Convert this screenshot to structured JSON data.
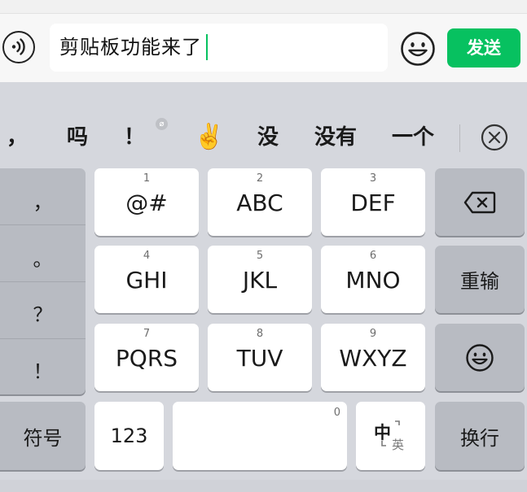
{
  "input": {
    "text": "剪贴板功能来了",
    "send_label": "发送"
  },
  "candidates": [
    {
      "text": "，"
    },
    {
      "text": "吗"
    },
    {
      "text": "！"
    },
    {
      "text": "✌️"
    },
    {
      "text": "没"
    },
    {
      "text": "没有"
    },
    {
      "text": "一个"
    }
  ],
  "punctuation": [
    "，",
    "。",
    "？",
    "！"
  ],
  "keys": [
    {
      "num": "1",
      "label": "@#"
    },
    {
      "num": "2",
      "label": "ABC"
    },
    {
      "num": "3",
      "label": "DEF"
    },
    {
      "num": "4",
      "label": "GHI"
    },
    {
      "num": "5",
      "label": "JKL"
    },
    {
      "num": "6",
      "label": "MNO"
    },
    {
      "num": "7",
      "label": "PQRS"
    },
    {
      "num": "8",
      "label": "TUV"
    },
    {
      "num": "9",
      "label": "WXYZ"
    }
  ],
  "side": {
    "retype_label": "重输",
    "symbols_label": "符号",
    "numbers_label": "123",
    "space_num": "0",
    "zh_label": "中",
    "en_label": "英",
    "newline_label": "换行"
  },
  "colors": {
    "accent": "#07c160",
    "keyboard_bg": "#d5d7dd",
    "function_key": "#b8bbc2"
  },
  "icons": [
    "voice-input-icon",
    "emoji-icon",
    "close-candidates-icon",
    "backspace-icon",
    "emoji-key-icon"
  ]
}
